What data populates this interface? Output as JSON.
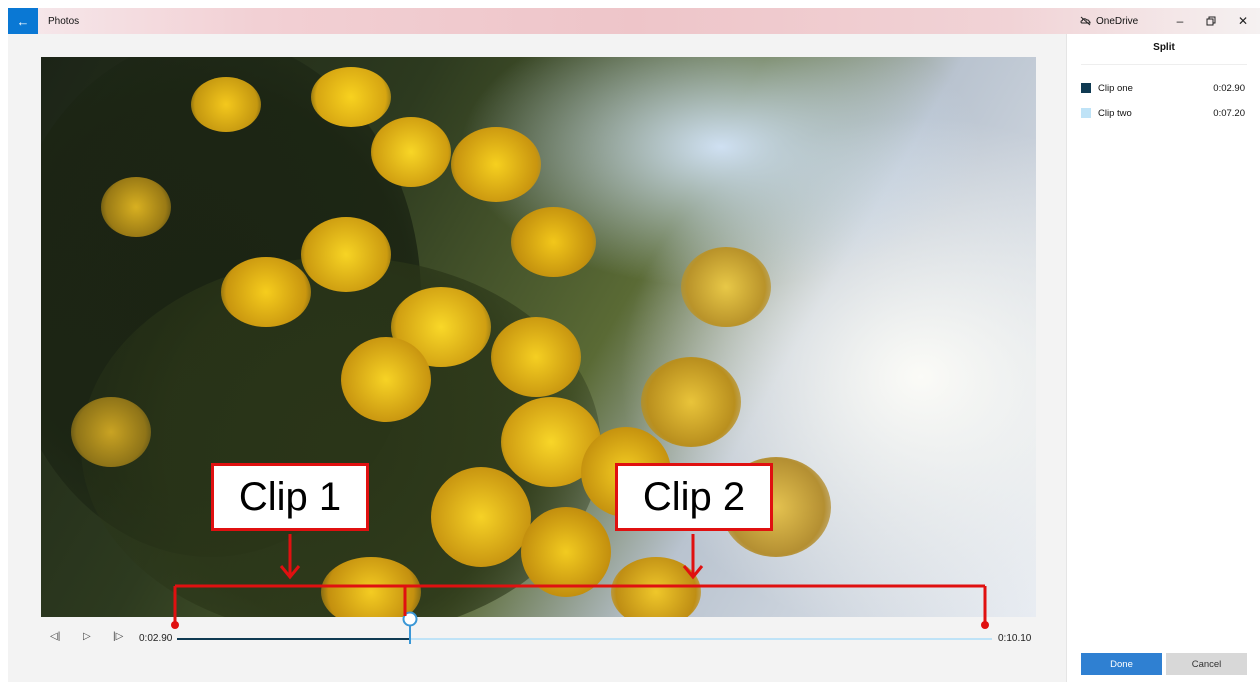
{
  "window": {
    "app_title": "Photos",
    "back_icon": "arrow-left-icon",
    "onedrive_label": "OneDrive",
    "controls": [
      "minimize-icon",
      "restore-icon",
      "close-icon"
    ],
    "accent": "#0a78d4"
  },
  "panel": {
    "title": "Split",
    "clips": [
      {
        "label": "Clip one",
        "duration": "0:02.90",
        "color": "#0f3a52"
      },
      {
        "label": "Clip two",
        "duration": "0:07.20",
        "color": "#bfe3f7"
      }
    ],
    "done_label": "Done",
    "cancel_label": "Cancel"
  },
  "player": {
    "current_time": "0:02.90",
    "total_time": "0:10.10",
    "split_position": 0.287,
    "icons": [
      "previous-frame-icon",
      "play-icon",
      "next-frame-icon"
    ]
  },
  "annotations": {
    "clip1_label": "Clip 1",
    "clip2_label": "Clip 2",
    "color": "#e01010"
  }
}
